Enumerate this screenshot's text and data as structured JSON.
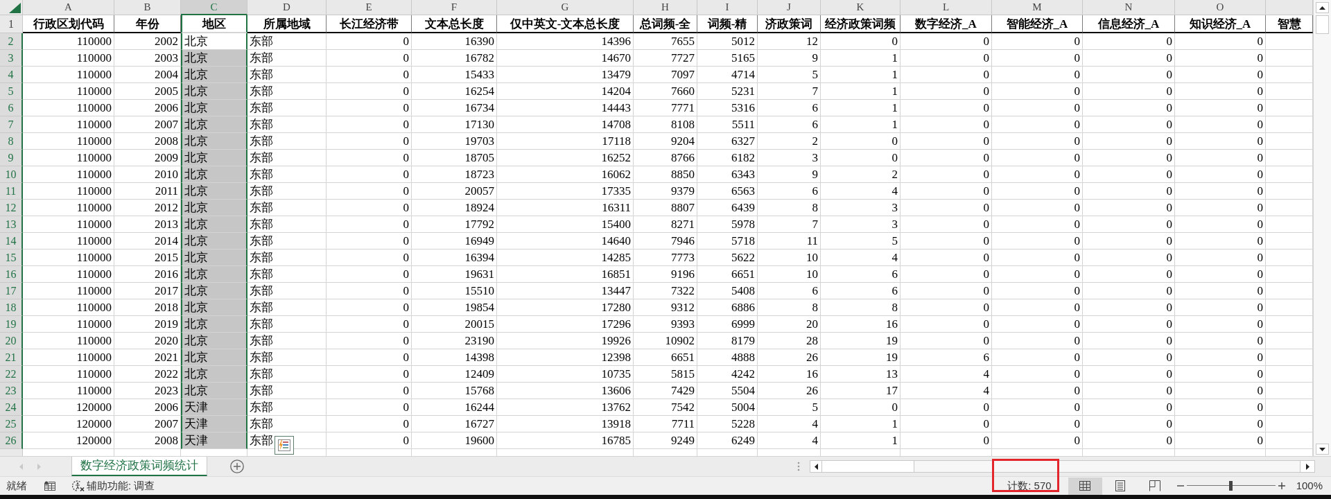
{
  "column_headers": [
    {
      "label": "A",
      "kind": "number",
      "selected": false
    },
    {
      "label": "B",
      "kind": "number",
      "selected": false
    },
    {
      "label": "C",
      "kind": "text",
      "selected": true
    },
    {
      "label": "D",
      "kind": "text",
      "selected": false
    },
    {
      "label": "E",
      "kind": "number",
      "selected": false
    },
    {
      "label": "F",
      "kind": "number",
      "selected": false
    },
    {
      "label": "G",
      "kind": "number",
      "selected": false
    },
    {
      "label": "H",
      "kind": "number",
      "selected": false
    },
    {
      "label": "I",
      "kind": "number",
      "selected": false
    },
    {
      "label": "J",
      "kind": "number",
      "selected": false
    },
    {
      "label": "K",
      "kind": "number",
      "selected": false
    },
    {
      "label": "L",
      "kind": "number",
      "selected": false
    },
    {
      "label": "M",
      "kind": "number",
      "selected": false
    },
    {
      "label": "N",
      "kind": "number",
      "selected": false
    },
    {
      "label": "O",
      "kind": "number",
      "selected": false
    },
    {
      "selected": false
    }
  ],
  "rows": [
    {
      "number": "1",
      "kind": "header",
      "selected": false,
      "cells": [
        "行政区划代码",
        "年份",
        "地区",
        "所属地域",
        "长江经济带",
        "文本总长度",
        "仅中英文-文本总长度",
        "总词频-全",
        "词频-精",
        "济政策词",
        "经济政策词频",
        "数字经济_A",
        "智能经济_A",
        "信息经济_A",
        "知识经济_A",
        "智慧"
      ]
    },
    {
      "number": "2",
      "kind": "data",
      "selected": true,
      "active": true,
      "cells": [
        "110000",
        "2002",
        "北京",
        "东部",
        "0",
        "16390",
        "14396",
        "7655",
        "5012",
        "12",
        "0",
        "0",
        "0",
        "0",
        "0"
      ]
    },
    {
      "number": "3",
      "kind": "data",
      "selected": true,
      "active": false,
      "cells": [
        "110000",
        "2003",
        "北京",
        "东部",
        "0",
        "16782",
        "14670",
        "7727",
        "5165",
        "9",
        "1",
        "0",
        "0",
        "0",
        "0"
      ]
    },
    {
      "number": "4",
      "kind": "data",
      "selected": true,
      "active": false,
      "cells": [
        "110000",
        "2004",
        "北京",
        "东部",
        "0",
        "15433",
        "13479",
        "7097",
        "4714",
        "5",
        "1",
        "0",
        "0",
        "0",
        "0"
      ]
    },
    {
      "number": "5",
      "kind": "data",
      "selected": true,
      "active": false,
      "cells": [
        "110000",
        "2005",
        "北京",
        "东部",
        "0",
        "16254",
        "14204",
        "7660",
        "5231",
        "7",
        "1",
        "0",
        "0",
        "0",
        "0"
      ]
    },
    {
      "number": "6",
      "kind": "data",
      "selected": true,
      "active": false,
      "cells": [
        "110000",
        "2006",
        "北京",
        "东部",
        "0",
        "16734",
        "14443",
        "7771",
        "5316",
        "6",
        "1",
        "0",
        "0",
        "0",
        "0"
      ]
    },
    {
      "number": "7",
      "kind": "data",
      "selected": true,
      "active": false,
      "cells": [
        "110000",
        "2007",
        "北京",
        "东部",
        "0",
        "17130",
        "14708",
        "8108",
        "5511",
        "6",
        "1",
        "0",
        "0",
        "0",
        "0"
      ]
    },
    {
      "number": "8",
      "kind": "data",
      "selected": true,
      "active": false,
      "cells": [
        "110000",
        "2008",
        "北京",
        "东部",
        "0",
        "19703",
        "17118",
        "9204",
        "6327",
        "2",
        "0",
        "0",
        "0",
        "0",
        "0"
      ]
    },
    {
      "number": "9",
      "kind": "data",
      "selected": true,
      "active": false,
      "cells": [
        "110000",
        "2009",
        "北京",
        "东部",
        "0",
        "18705",
        "16252",
        "8766",
        "6182",
        "3",
        "0",
        "0",
        "0",
        "0",
        "0"
      ]
    },
    {
      "number": "10",
      "kind": "data",
      "selected": true,
      "active": false,
      "cells": [
        "110000",
        "2010",
        "北京",
        "东部",
        "0",
        "18723",
        "16062",
        "8850",
        "6343",
        "9",
        "2",
        "0",
        "0",
        "0",
        "0"
      ]
    },
    {
      "number": "11",
      "kind": "data",
      "selected": true,
      "active": false,
      "cells": [
        "110000",
        "2011",
        "北京",
        "东部",
        "0",
        "20057",
        "17335",
        "9379",
        "6563",
        "6",
        "4",
        "0",
        "0",
        "0",
        "0"
      ]
    },
    {
      "number": "12",
      "kind": "data",
      "selected": true,
      "active": false,
      "cells": [
        "110000",
        "2012",
        "北京",
        "东部",
        "0",
        "18924",
        "16311",
        "8807",
        "6439",
        "8",
        "3",
        "0",
        "0",
        "0",
        "0"
      ]
    },
    {
      "number": "13",
      "kind": "data",
      "selected": true,
      "active": false,
      "cells": [
        "110000",
        "2013",
        "北京",
        "东部",
        "0",
        "17792",
        "15400",
        "8271",
        "5978",
        "7",
        "3",
        "0",
        "0",
        "0",
        "0"
      ]
    },
    {
      "number": "14",
      "kind": "data",
      "selected": true,
      "active": false,
      "cells": [
        "110000",
        "2014",
        "北京",
        "东部",
        "0",
        "16949",
        "14640",
        "7946",
        "5718",
        "11",
        "5",
        "0",
        "0",
        "0",
        "0"
      ]
    },
    {
      "number": "15",
      "kind": "data",
      "selected": true,
      "active": false,
      "cells": [
        "110000",
        "2015",
        "北京",
        "东部",
        "0",
        "16394",
        "14285",
        "7773",
        "5622",
        "10",
        "4",
        "0",
        "0",
        "0",
        "0"
      ]
    },
    {
      "number": "16",
      "kind": "data",
      "selected": true,
      "active": false,
      "cells": [
        "110000",
        "2016",
        "北京",
        "东部",
        "0",
        "19631",
        "16851",
        "9196",
        "6651",
        "10",
        "6",
        "0",
        "0",
        "0",
        "0"
      ]
    },
    {
      "number": "17",
      "kind": "data",
      "selected": true,
      "active": false,
      "cells": [
        "110000",
        "2017",
        "北京",
        "东部",
        "0",
        "15510",
        "13447",
        "7322",
        "5408",
        "6",
        "6",
        "0",
        "0",
        "0",
        "0"
      ]
    },
    {
      "number": "18",
      "kind": "data",
      "selected": true,
      "active": false,
      "cells": [
        "110000",
        "2018",
        "北京",
        "东部",
        "0",
        "19854",
        "17280",
        "9312",
        "6886",
        "8",
        "8",
        "0",
        "0",
        "0",
        "0"
      ]
    },
    {
      "number": "19",
      "kind": "data",
      "selected": true,
      "active": false,
      "cells": [
        "110000",
        "2019",
        "北京",
        "东部",
        "0",
        "20015",
        "17296",
        "9393",
        "6999",
        "20",
        "16",
        "0",
        "0",
        "0",
        "0"
      ]
    },
    {
      "number": "20",
      "kind": "data",
      "selected": true,
      "active": false,
      "cells": [
        "110000",
        "2020",
        "北京",
        "东部",
        "0",
        "23190",
        "19926",
        "10902",
        "8179",
        "28",
        "19",
        "0",
        "0",
        "0",
        "0"
      ]
    },
    {
      "number": "21",
      "kind": "data",
      "selected": true,
      "active": false,
      "cells": [
        "110000",
        "2021",
        "北京",
        "东部",
        "0",
        "14398",
        "12398",
        "6651",
        "4888",
        "26",
        "19",
        "6",
        "0",
        "0",
        "0"
      ]
    },
    {
      "number": "22",
      "kind": "data",
      "selected": true,
      "active": false,
      "cells": [
        "110000",
        "2022",
        "北京",
        "东部",
        "0",
        "12409",
        "10735",
        "5815",
        "4242",
        "16",
        "13",
        "4",
        "0",
        "0",
        "0"
      ]
    },
    {
      "number": "23",
      "kind": "data",
      "selected": true,
      "active": false,
      "cells": [
        "110000",
        "2023",
        "北京",
        "东部",
        "0",
        "15768",
        "13606",
        "7429",
        "5504",
        "26",
        "17",
        "4",
        "0",
        "0",
        "0"
      ]
    },
    {
      "number": "24",
      "kind": "data",
      "selected": true,
      "active": false,
      "cells": [
        "120000",
        "2006",
        "天津",
        "东部",
        "0",
        "16244",
        "13762",
        "7542",
        "5004",
        "5",
        "0",
        "0",
        "0",
        "0",
        "0"
      ]
    },
    {
      "number": "25",
      "kind": "data",
      "selected": true,
      "active": false,
      "cells": [
        "120000",
        "2007",
        "天津",
        "东部",
        "0",
        "16727",
        "13918",
        "7711",
        "5228",
        "4",
        "1",
        "0",
        "0",
        "0",
        "0"
      ]
    },
    {
      "number": "26",
      "kind": "data",
      "selected": true,
      "active": false,
      "cells": [
        "120000",
        "2008",
        "天津",
        "东部",
        "0",
        "19600",
        "16785",
        "9249",
        "6249",
        "4",
        "1",
        "0",
        "0",
        "0",
        "0"
      ]
    }
  ],
  "sheet_tabs": [
    {
      "label": "数字经济政策词频统计",
      "selected": true
    }
  ],
  "status_bar": {
    "mode": "就绪",
    "accessibility": "辅助功能: 调查",
    "count": "计数: 570",
    "views": [
      {
        "kind": "normal",
        "selected": true
      },
      {
        "kind": "page_layout",
        "selected": false
      },
      {
        "kind": "page_break_preview",
        "selected": false
      }
    ],
    "zoom": {
      "level": 0.5,
      "reading": "100%"
    }
  }
}
